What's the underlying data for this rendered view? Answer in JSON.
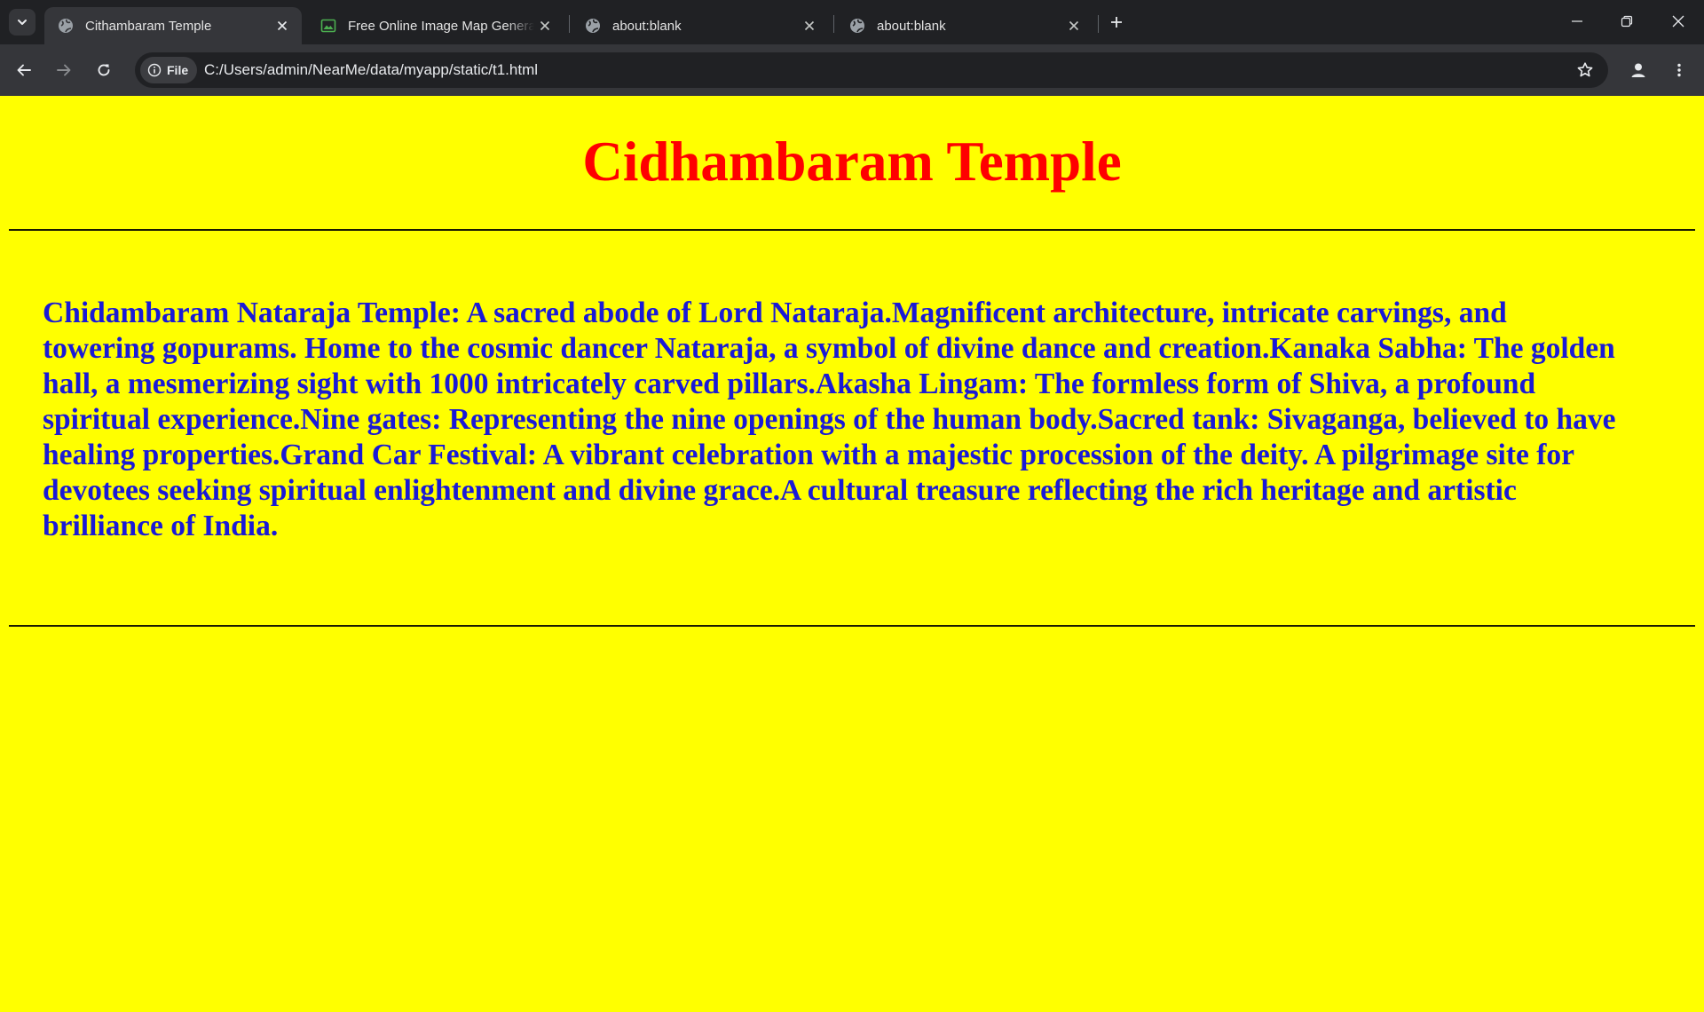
{
  "browser": {
    "tabs": [
      {
        "title": "Cithambaram Temple",
        "icon": "globe-icon",
        "active": true
      },
      {
        "title": "Free Online Image Map Generator",
        "icon": "image-icon",
        "active": false
      },
      {
        "title": "about:blank",
        "icon": "globe-icon",
        "active": false
      },
      {
        "title": "about:blank",
        "icon": "globe-icon",
        "active": false
      }
    ],
    "omnibox": {
      "chip_label": "File",
      "url": "C:/Users/admin/NearMe/data/myapp/static/t1.html"
    }
  },
  "page": {
    "title": "Cidhambaram Temple",
    "paragraph": "Chidambaram Nataraja Temple: A sacred abode of Lord Nataraja.Magnificent architecture, intricate carvings, and towering gopurams. Home to the cosmic dancer Nataraja, a symbol of divine dance and creation.Kanaka Sabha: The golden hall, a mesmerizing sight with 1000 intricately carved pillars.Akasha Lingam: The formless form of Shiva, a profound spiritual experience.Nine gates: Representing the nine openings of the human body.Sacred tank: Sivaganga, believed to have healing properties.Grand Car Festival: A vibrant celebration with a majestic procession of the deity. A pilgrimage site for devotees seeking spiritual enlightenment and divine grace.A cultural treasure reflecting the rich heritage and artistic brilliance of India."
  },
  "colors": {
    "page_background": "#ffff00",
    "title_color": "#ff0000",
    "text_color": "#1a1ad6",
    "browser_frame": "#202124",
    "toolbar": "#35363a"
  }
}
